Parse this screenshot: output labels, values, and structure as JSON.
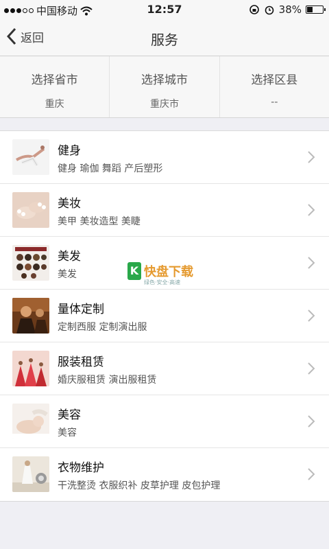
{
  "status": {
    "carrier": "中国移动",
    "time": "12:57",
    "battery": "38%",
    "battery_level": 0.38
  },
  "nav": {
    "back_label": "返回",
    "title": "服务"
  },
  "selectors": [
    {
      "label": "选择省市",
      "value": "重庆"
    },
    {
      "label": "选择城市",
      "value": "重庆市"
    },
    {
      "label": "选择区县",
      "value": "--"
    }
  ],
  "services": [
    {
      "title": "健身",
      "subtitle": "健身 瑜伽 舞蹈 产后塑形",
      "thumb": "fitness-thumbnail"
    },
    {
      "title": "美妆",
      "subtitle": "美甲 美妆造型 美睫",
      "thumb": "makeup-thumbnail"
    },
    {
      "title": "美发",
      "subtitle": "美发",
      "thumb": "hairdressing-thumbnail"
    },
    {
      "title": "量体定制",
      "subtitle": "定制西服 定制演出服",
      "thumb": "tailoring-thumbnail"
    },
    {
      "title": "服装租赁",
      "subtitle": "婚庆服租赁 演出服租赁",
      "thumb": "rental-thumbnail"
    },
    {
      "title": "美容",
      "subtitle": "美容",
      "thumb": "beauty-thumbnail"
    },
    {
      "title": "衣物维护",
      "subtitle": "干洗整烫 衣服织补 皮草护理 皮包护理",
      "thumb": "clothing-care-thumbnail"
    }
  ],
  "watermark": {
    "logo": "K",
    "text": "快盘下载",
    "sub": "绿色·安全·高速"
  }
}
